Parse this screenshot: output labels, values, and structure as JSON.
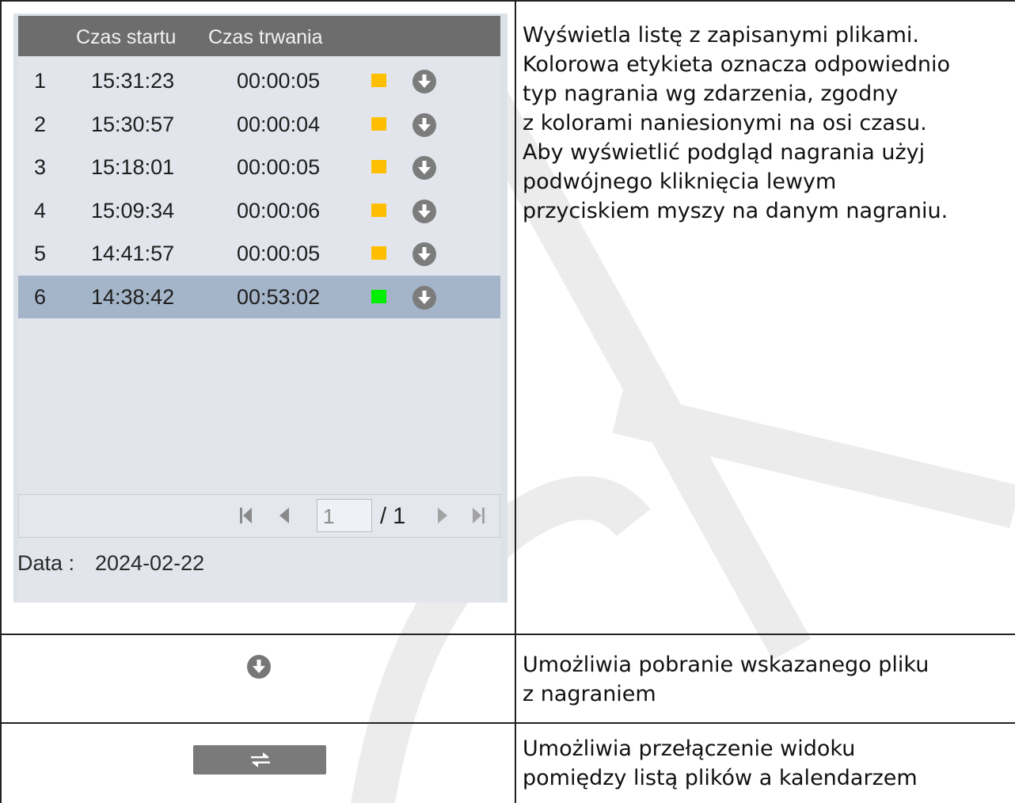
{
  "panel": {
    "header": {
      "start_label": "Czas startu",
      "duration_label": "Czas trwania"
    },
    "rows": [
      {
        "index": "1",
        "start": "15:31:23",
        "duration": "00:00:05",
        "color": "#ffbf00",
        "selected": false
      },
      {
        "index": "2",
        "start": "15:30:57",
        "duration": "00:00:04",
        "color": "#ffbf00",
        "selected": false
      },
      {
        "index": "3",
        "start": "15:18:01",
        "duration": "00:00:05",
        "color": "#ffbf00",
        "selected": false
      },
      {
        "index": "4",
        "start": "15:09:34",
        "duration": "00:00:06",
        "color": "#ffbf00",
        "selected": false
      },
      {
        "index": "5",
        "start": "14:41:57",
        "duration": "00:00:05",
        "color": "#ffbf00",
        "selected": false
      },
      {
        "index": "6",
        "start": "14:38:42",
        "duration": "00:53:02",
        "color": "#00ee00",
        "selected": true
      }
    ],
    "pager": {
      "page": "1",
      "total": "/ 1"
    },
    "date": {
      "label": "Data :",
      "value": "2024-02-22"
    }
  },
  "descriptions": {
    "list": [
      "Wyświetla listę z zapisanymi plikami.",
      "Kolorowa etykieta oznacza odpowiednio",
      "typ nagrania wg zdarzenia, zgodny",
      "z kolorami naniesionymi na osi czasu.",
      "Aby wyświetlić podgląd nagrania użyj",
      "podwójnego kliknięcia lewym",
      "przyciskiem myszy na danym nagraniu."
    ],
    "download": [
      "Umożliwia pobranie wskazanego pliku",
      "z nagraniem"
    ],
    "switch": [
      "Umożliwia przełączenie widoku",
      "pomiędzy listą plików a kalendarzem"
    ]
  },
  "colors": {
    "header_bg": "#6d6d6d",
    "selected_row": "#a5b5c9",
    "panel_bg": "#e2e6ec",
    "event_orange": "#ffbf00",
    "event_green": "#00ee00"
  },
  "icons": {
    "download": "download-circle-icon",
    "switch": "swap-arrows-icon",
    "first": "first-page-icon",
    "prev": "prev-page-icon",
    "next": "next-page-icon",
    "last": "last-page-icon"
  }
}
